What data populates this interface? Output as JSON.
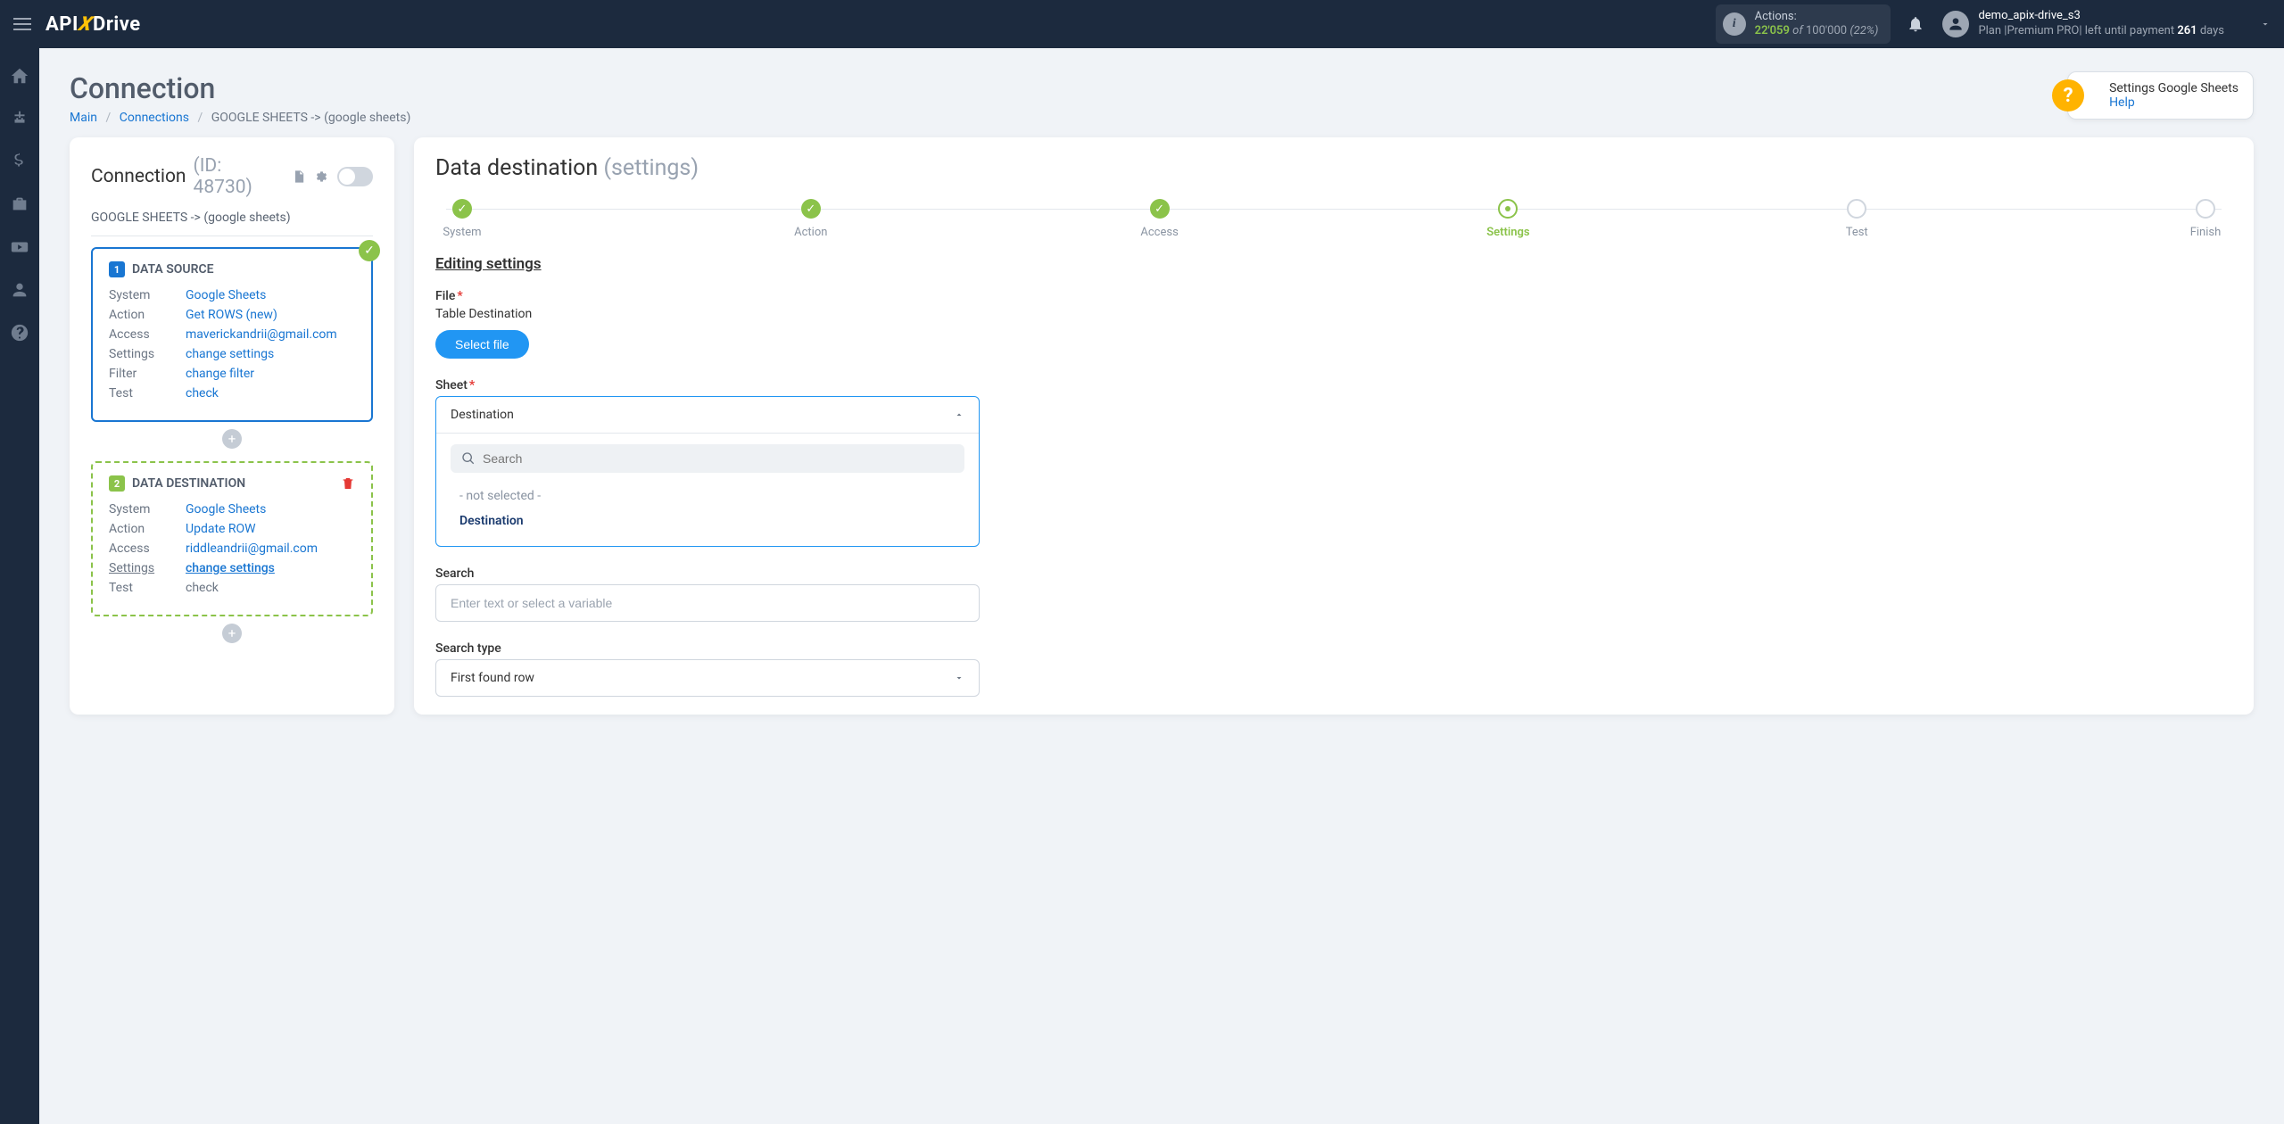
{
  "topbar": {
    "actions_label": "Actions:",
    "actions_used": "22'059",
    "actions_of": "of",
    "actions_total": "100'000",
    "actions_pct": "(22%)",
    "user_name": "demo_apix-drive_s3",
    "plan_prefix": "Plan |Premium PRO| left until payment ",
    "plan_days": "261",
    "plan_suffix": " days"
  },
  "page": {
    "title": "Connection",
    "crumb_main": "Main",
    "crumb_connections": "Connections",
    "crumb_current": "GOOGLE SHEETS -> (google sheets)"
  },
  "help": {
    "line1": "Settings Google Sheets",
    "line2": "Help"
  },
  "conn_panel": {
    "heading": "Connection",
    "id_label": "(ID: 48730)",
    "sub": "GOOGLE SHEETS -> (google sheets)",
    "src_title": "DATA SOURCE",
    "dst_title": "DATA DESTINATION",
    "rows": {
      "system_k": "System",
      "action_k": "Action",
      "access_k": "Access",
      "settings_k": "Settings",
      "filter_k": "Filter",
      "test_k": "Test"
    },
    "src": {
      "system": "Google Sheets",
      "action": "Get ROWS (new)",
      "access": "maverickandrii@gmail.com",
      "settings": "change settings",
      "filter": "change filter",
      "test": "check"
    },
    "dst": {
      "system": "Google Sheets",
      "action": "Update ROW",
      "access": "riddleandrii@gmail.com",
      "settings": "change settings",
      "test": "check"
    }
  },
  "dest": {
    "title": "Data destination",
    "title_sub": "(settings)",
    "steps": [
      "System",
      "Action",
      "Access",
      "Settings",
      "Test",
      "Finish"
    ],
    "section": "Editing settings",
    "file_label": "File",
    "file_value": "Table Destination",
    "select_file_btn": "Select file",
    "sheet_label": "Sheet",
    "sheet_selected": "Destination",
    "sheet_search_ph": "Search",
    "sheet_opt_ns": "- not selected -",
    "sheet_opt_dest": "Destination",
    "search_label": "Search",
    "search_ph": "Enter text or select a variable",
    "searchtype_label": "Search type",
    "searchtype_value": "First found row"
  }
}
